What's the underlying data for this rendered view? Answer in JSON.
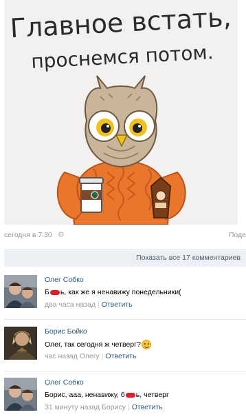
{
  "post": {
    "image_caption_line1": "Главное встать,",
    "image_caption_line2": "проснемся потом.",
    "date": "сегодня в 7:30",
    "share_label": "Поде",
    "show_all_comments": "Показать все 17 комментариев"
  },
  "comments": [
    {
      "author": "Олег Собко",
      "text_before": "Б",
      "text_after": "ь, как же я ненавижу понедельники(",
      "time": "два часа назад",
      "reply": "Ответить"
    },
    {
      "author": "Борис Бойко",
      "text": "Олег, так сегодня ж четверг?",
      "time": "час назад Олегу",
      "reply": "Ответить"
    },
    {
      "author": "Олег Собко",
      "text_before": "Борис, ааа, ненавижу, б",
      "text_after": "ь, четверг",
      "time": "31 минуту назад Борису",
      "reply": "Ответить"
    }
  ],
  "colors": {
    "link": "#2b587a",
    "muted": "#999999",
    "show_all_bg": "#eceff3",
    "sweater": "#e9762a",
    "censor": "#e0202c"
  }
}
